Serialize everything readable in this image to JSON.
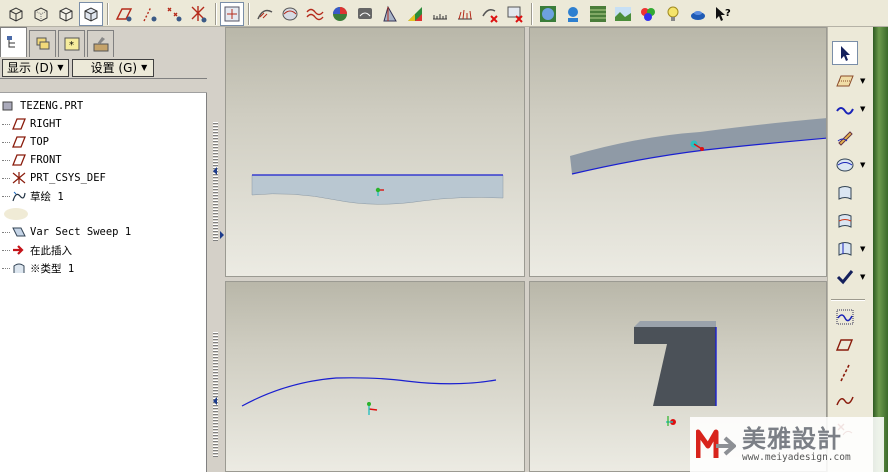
{
  "toolbar": {
    "icons": [
      "view-shaded-cube-icon",
      "view-wireframe-cube-icon",
      "view-hidden-cube-icon",
      "view-no-hidden-cube-icon",
      "datum-plane-display-icon",
      "datum-axis-display-icon",
      "datum-point-display-icon",
      "coordinate-system-display-icon",
      "spin-center-icon",
      "analysis-curve-icon",
      "analysis-surface-icon",
      "analysis-wave-icon",
      "analysis-color-sphere-icon",
      "analysis-shading-icon",
      "analysis-draft-icon",
      "analysis-color-area-icon",
      "analysis-ruler-icon",
      "analysis-curvature-icon",
      "analysis-delete-icon",
      "analysis-close-icon",
      "model-sphere-icon",
      "model-person-icon",
      "model-texture-icon",
      "model-landscape-icon",
      "color-wheel-icon",
      "light-bulb-icon",
      "appearance-teapot-icon",
      "context-help-icon"
    ]
  },
  "panel": {
    "tabs": [
      "model-tree-tab",
      "layers-tab",
      "favorites-tab",
      "tools-tab"
    ],
    "show_menu": "显示 (D)",
    "settings_menu": "设置 (G)",
    "tree": [
      {
        "label": "TEZENG.PRT",
        "icon": "part-icon"
      },
      {
        "label": "RIGHT",
        "icon": "datum-plane-icon"
      },
      {
        "label": "TOP",
        "icon": "datum-plane-icon"
      },
      {
        "label": "FRONT",
        "icon": "datum-plane-icon"
      },
      {
        "label": "PRT_CSYS_DEF",
        "icon": "coordinate-system-icon"
      },
      {
        "label": "草绘 1",
        "icon": "sketch-icon"
      },
      {
        "label": "",
        "icon": "hidden-feature-icon"
      },
      {
        "label": "Var Sect Sweep 1",
        "icon": "var-sect-sweep-icon"
      },
      {
        "label": "在此插入",
        "icon": "insert-here-arrow-icon"
      },
      {
        "label": "※类型 1",
        "icon": "surface-feature-icon"
      }
    ]
  },
  "viewports": [
    "front-view",
    "isometric-view",
    "top-view",
    "right-view"
  ],
  "right_toolbar": {
    "icons": [
      "select-arrow-icon",
      "datum-plane-tool-icon",
      "sketched-curve-tool-icon",
      "pen-sketch-icon",
      "style-surface-icon",
      "boundary-surface-icon",
      "curve-on-surface-icon",
      "surface-trim-icon",
      "check-done-icon",
      "wave-curve-icon",
      "plane-icon",
      "dashed-line-icon",
      "curve-icon",
      "curve-extra-icon"
    ]
  },
  "watermark": {
    "title": "美雅設計",
    "url": "www.meiyadesign.com",
    "logo_icon": "meiya-logo-icon"
  },
  "colors": {
    "curve_blue": "#1a1fd0",
    "surface": "#b9c4cc",
    "solid": "#4b5158"
  }
}
